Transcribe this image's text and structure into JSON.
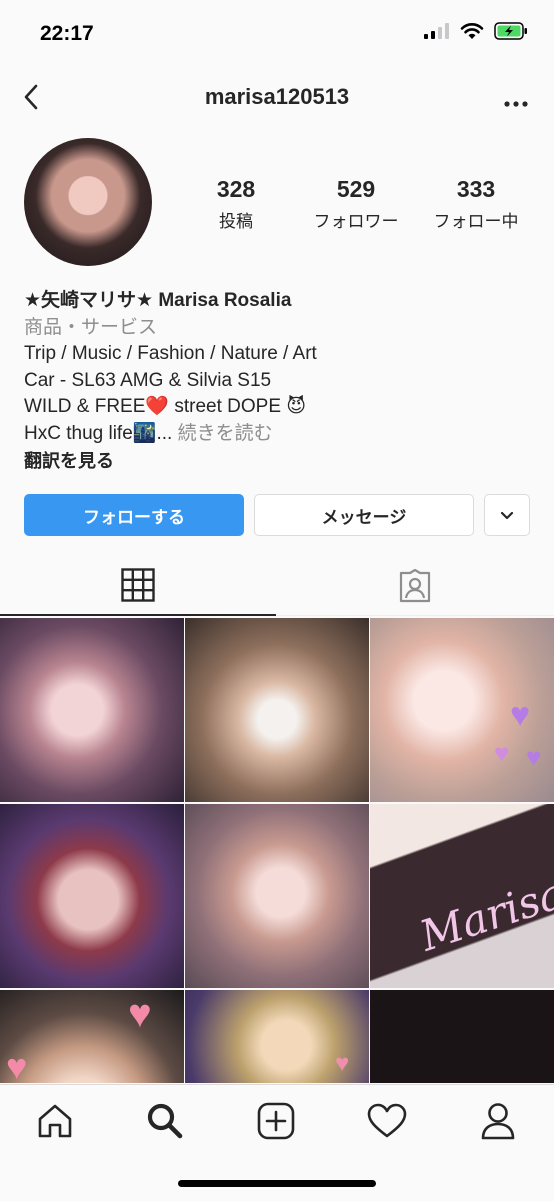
{
  "status_bar": {
    "time": "22:17",
    "icons": [
      "signal-icon",
      "wifi-icon",
      "battery-charging-icon"
    ],
    "battery_color": "#4cd964"
  },
  "nav": {
    "username": "marisa120513",
    "back_icon": "chevron-left-icon",
    "more_icon": "more-horizontal-icon"
  },
  "profile": {
    "avatar_icon": "profile-avatar",
    "stats": [
      {
        "count": "328",
        "label": "投稿"
      },
      {
        "count": "529",
        "label": "フォロワー"
      },
      {
        "count": "333",
        "label": "フォロー中"
      }
    ]
  },
  "bio": {
    "name": "★矢崎マリサ★ Marisa Rosalia",
    "category": "商品・サービス",
    "line1": "Trip / Music / Fashion / Nature / Art",
    "line2": "Car - SL63 AMG & Silvia S15",
    "line3_text": "WILD & FREE",
    "line3_heart": "❤️",
    "line3_rest": " street DOPE ",
    "line3_devil": "😈",
    "line4_text": "HxC thug life",
    "line4_city": "🌃",
    "line4_ellipsis": "... ",
    "more_label": "続きを読む",
    "translate_label": "翻訳を見る"
  },
  "actions": {
    "follow_label": "フォローする",
    "message_label": "メッセージ",
    "dropdown_icon": "chevron-down-icon",
    "accent_color": "#3897f0"
  },
  "tabs": [
    {
      "name": "grid",
      "icon": "grid-icon",
      "active": true
    },
    {
      "name": "tagged",
      "icon": "tagged-person-icon",
      "active": false
    }
  ],
  "posts": [
    {
      "icon": "photo-thumbnail"
    },
    {
      "icon": "photo-thumbnail"
    },
    {
      "icon": "photo-thumbnail"
    },
    {
      "icon": "photo-thumbnail"
    },
    {
      "icon": "photo-thumbnail"
    },
    {
      "icon": "photo-thumbnail",
      "caption": "Marisa"
    },
    {
      "icon": "photo-thumbnail"
    },
    {
      "icon": "photo-thumbnail"
    },
    {
      "icon": "photo-thumbnail"
    }
  ],
  "bottom_nav": [
    "home-icon",
    "search-icon",
    "new-post-icon",
    "activity-heart-icon",
    "profile-icon"
  ]
}
